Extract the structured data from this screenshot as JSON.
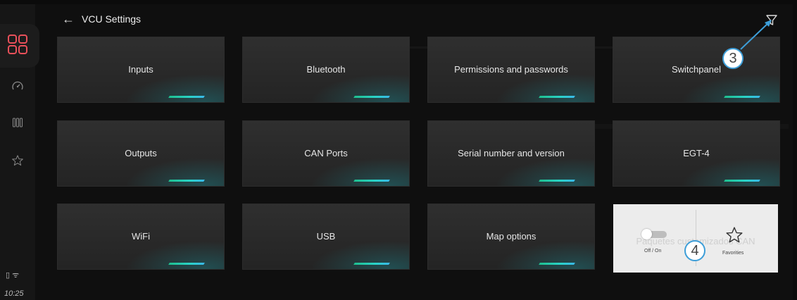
{
  "header": {
    "back_label": "←",
    "title": "VCU Settings"
  },
  "sidebar": {
    "items": [
      {
        "icon": "grid-icon"
      },
      {
        "icon": "gauge-icon"
      },
      {
        "icon": "columns-icon"
      },
      {
        "icon": "star-icon"
      }
    ],
    "status": "▯ ᯤ",
    "time": "10:25"
  },
  "tiles": [
    {
      "label": "Inputs"
    },
    {
      "label": "Bluetooth"
    },
    {
      "label": "Permissions and passwords"
    },
    {
      "label": "Switchpanel"
    },
    {
      "label": "Outputs"
    },
    {
      "label": "CAN Ports"
    },
    {
      "label": "Serial number and version"
    },
    {
      "label": "EGT-4"
    },
    {
      "label": "WiFi"
    },
    {
      "label": "USB"
    },
    {
      "label": "Map options"
    }
  ],
  "favorites_panel": {
    "ghost_text": "Paquetes customizados CAN",
    "toggle_label": "Off / On",
    "toggle_on": false,
    "favorites_label": "Favorities"
  },
  "callouts": {
    "c3": "3",
    "c4": "4"
  },
  "colors": {
    "accent_start": "#1fbf8f",
    "accent_end": "#39b8e8",
    "callout_border": "#3d9ed8"
  }
}
